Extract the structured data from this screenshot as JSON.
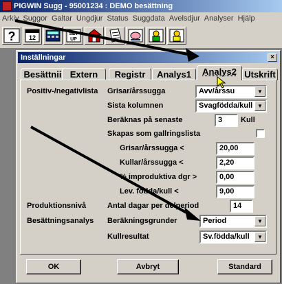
{
  "app": {
    "title": "PIGWIN Sugg - 95001234 : DEMO besättning",
    "menu": [
      "Arkiv",
      "Suggor",
      "Galtar",
      "Ungdjur",
      "Status",
      "Suggdata",
      "Avelsdjur",
      "Analyser",
      "Hjälp"
    ]
  },
  "toolbar": {
    "buttons": [
      {
        "name": "help-icon",
        "label": "?"
      },
      {
        "name": "calendar-icon",
        "label": "12"
      },
      {
        "name": "calculator-icon",
        "label": ""
      },
      {
        "name": "setup-icon",
        "label": "SET UP"
      },
      {
        "name": "barn-icon",
        "label": ""
      },
      {
        "name": "document-icon",
        "label": ""
      },
      {
        "name": "pig-icon",
        "label": ""
      },
      {
        "name": "user-green-icon",
        "label": ""
      },
      {
        "name": "user-yellow-icon",
        "label": ""
      }
    ]
  },
  "dialog": {
    "title": "Inställningar",
    "close_label": "×",
    "tabs": [
      "Besättnii",
      "Extern",
      "Registr",
      "Analys1",
      "Analys2",
      "Utskrift"
    ],
    "active_tab": "Analys2",
    "sections": {
      "positiv": "Positiv-/negativlista",
      "produktion": "Produktionsnivå",
      "besattning": "Besättningsanalys"
    },
    "fields": {
      "grisar_label": "Grisar/årssugga",
      "grisar_value": "Avv/årssu",
      "sista_label": "Sista kolumnen",
      "sista_value": "Svagfödda/kull",
      "beraknas_label": "Beräknas på senaste",
      "beraknas_value": "3",
      "beraknas_unit": "Kull",
      "gallring_label": "Skapas som gallringslista",
      "grisar_lt_label": "Grisar/årssugga <",
      "grisar_lt_value": "20,00",
      "kullar_label": "Kullar/årssugga <",
      "kullar_value": "2,20",
      "improd_label": "% improduktiva dgr >",
      "improd_value": "0,00",
      "levf_label": "Lev. födda/kull <",
      "levf_value": "9,00",
      "dagar_label": "Antal dagar per delperiod",
      "dagar_value": "14",
      "berakning_label": "Beräkningsgrunder",
      "berakning_value": "Period",
      "kull_label": "Kullresultat",
      "kull_value": "Sv.födda/kull"
    },
    "buttons": {
      "ok": "OK",
      "cancel": "Avbryt",
      "standard": "Standard"
    }
  }
}
